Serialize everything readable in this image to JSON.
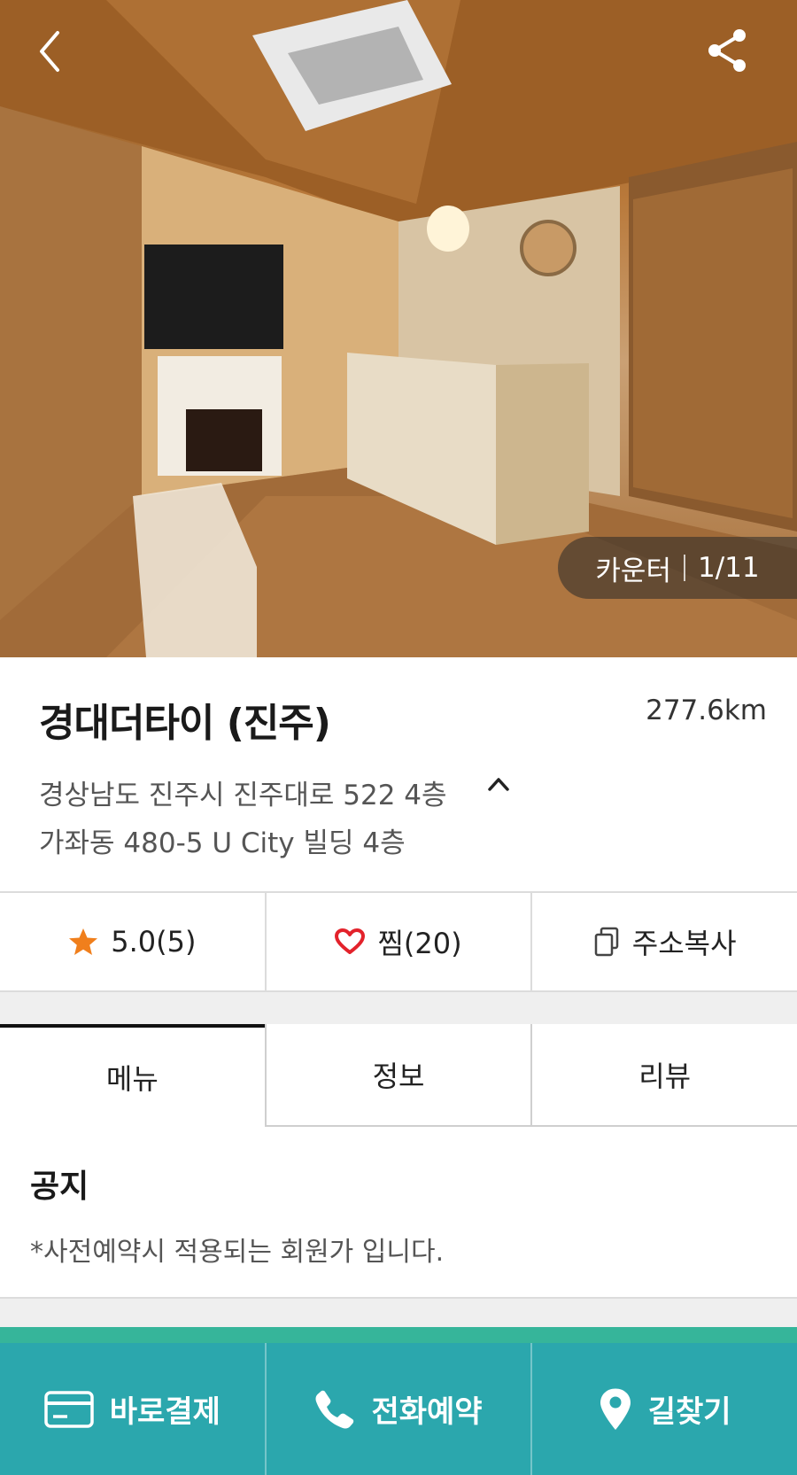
{
  "hero": {
    "caption_label": "카운터",
    "caption_counter": "1/11",
    "back_icon": "chevron-left-icon",
    "share_icon": "share-icon"
  },
  "place": {
    "name": "경대더타이 (진주)",
    "distance": "277.6km",
    "address_road": "경상남도 진주시 진주대로 522 4층",
    "address_lot": "가좌동 480-5 U City 빌딩 4층"
  },
  "actions": {
    "rating": "5.0(5)",
    "favorite": "찜(20)",
    "copy_address": "주소복사"
  },
  "tabs": [
    "메뉴",
    "정보",
    "리뷰"
  ],
  "active_tab": "메뉴",
  "notice": {
    "title": "공지",
    "text": "*사전예약시 적용되는 회원가 입니다."
  },
  "bottom_bar": {
    "pay": "바로결제",
    "call": "전화예약",
    "directions": "길찾기"
  },
  "colors": {
    "bottom_bar": "#2ba7ad",
    "star": "#f07f1c",
    "heart": "#e3222b"
  }
}
